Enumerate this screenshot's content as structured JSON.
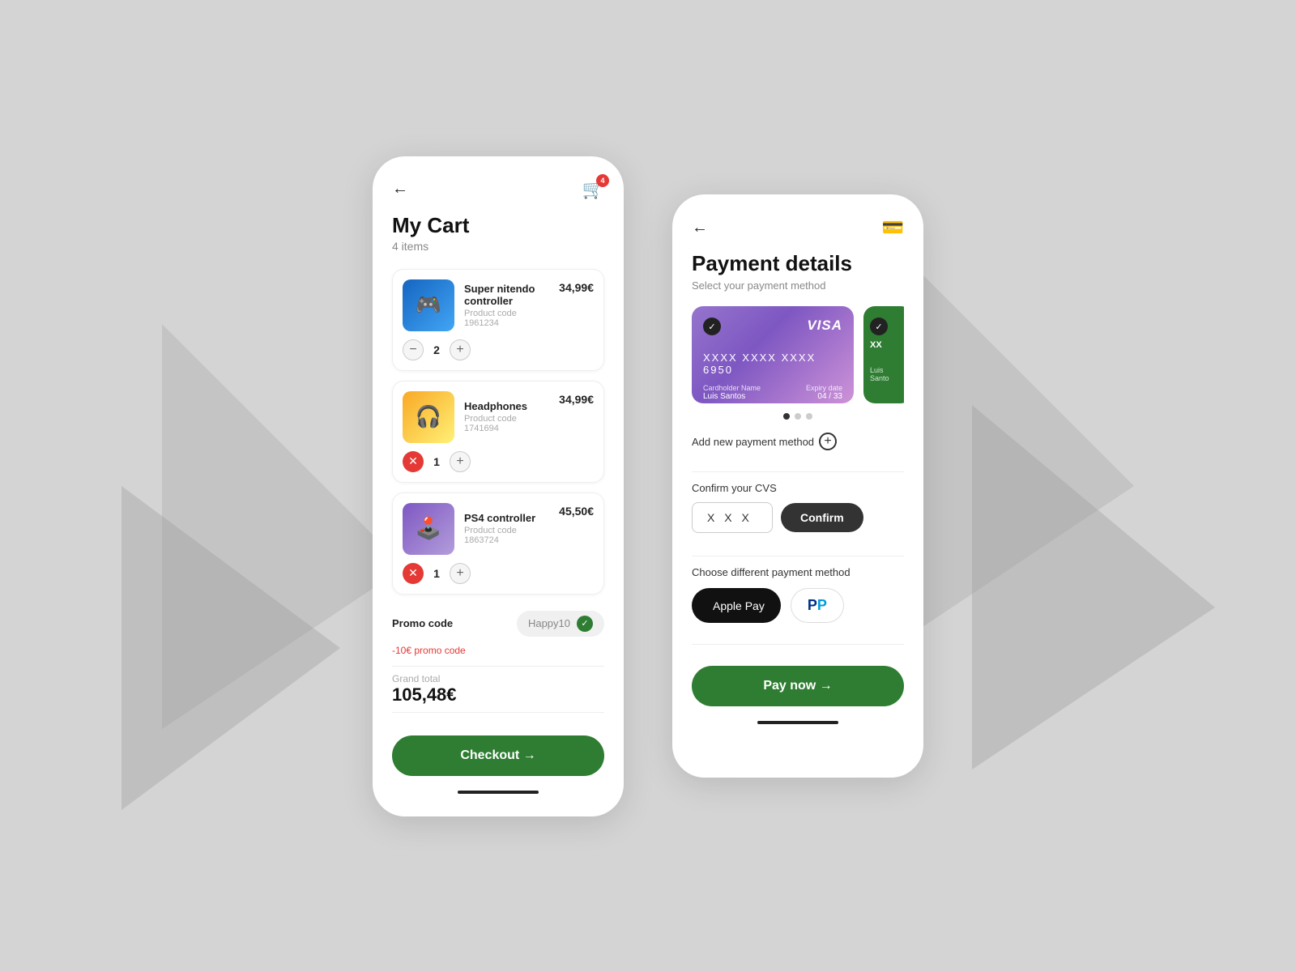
{
  "background": {
    "color": "#d4d4d4"
  },
  "cart_screen": {
    "back_label": "←",
    "cart_icon": "🛒",
    "badge_count": "4",
    "title": "My Cart",
    "subtitle": "4 items",
    "items": [
      {
        "name": "Super nitendo controller",
        "code": "Product code 1961234",
        "price": "34,99€",
        "qty": "2",
        "img_emoji": "🎮",
        "img_type": "controller"
      },
      {
        "name": "Headphones",
        "code": "Product code 1741694",
        "price": "34,99€",
        "qty": "1",
        "img_emoji": "🎧",
        "img_type": "headphones"
      },
      {
        "name": "PS4 controller",
        "code": "Product code 1863724",
        "price": "45,50€",
        "qty": "1",
        "img_emoji": "🎮",
        "img_type": "ps4"
      }
    ],
    "promo_label": "Promo code",
    "promo_value": "Happy10",
    "promo_discount": "-10€ promo code",
    "grand_total_label": "Grand total",
    "grand_total_value": "105,48€",
    "checkout_label": "Checkout →"
  },
  "payment_screen": {
    "back_label": "←",
    "title": "Payment details",
    "subtitle": "Select your payment method",
    "cards": [
      {
        "type": "visa",
        "number": "XXXX XXXX XXXX 6950",
        "cardholder_label": "Cardholder Name",
        "cardholder_value": "Luis Santos",
        "expiry_label": "Expiry date",
        "expiry_value": "04 / 33",
        "selected": true
      },
      {
        "type": "green",
        "partial": "XX",
        "cardholder_partial": "Luis Santo",
        "selected": true
      }
    ],
    "dots": [
      "active",
      "inactive",
      "inactive"
    ],
    "add_payment_label": "Add new payment method",
    "cvv_label": "Confirm your CVS",
    "cvv_placeholder": "X X X",
    "confirm_label": "Confirm",
    "diff_payment_label": "Choose different payment method",
    "apple_pay_label": "Apple Pay",
    "paypal_label": "PayPal",
    "pay_now_label": "Pay now →"
  }
}
